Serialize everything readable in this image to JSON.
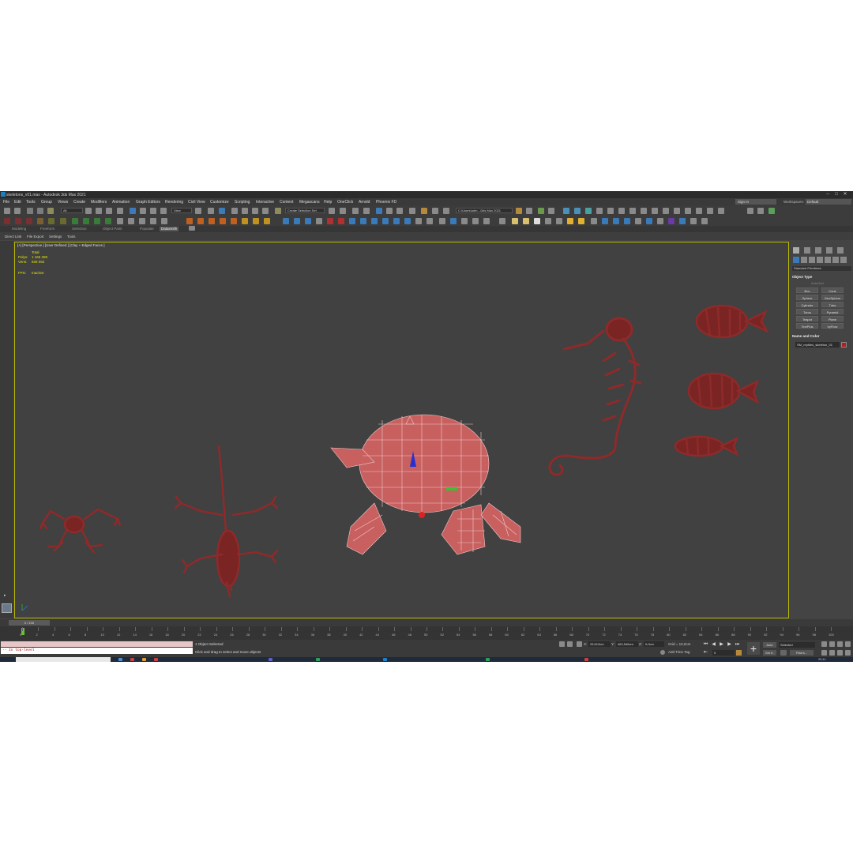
{
  "window": {
    "title": "skeletons_v01.max - Autodesk 3ds Max 2021",
    "controls": [
      "–",
      "□",
      "✕"
    ]
  },
  "menu": {
    "items": [
      "File",
      "Edit",
      "Tools",
      "Group",
      "Views",
      "Create",
      "Modifiers",
      "Animation",
      "Graph Editors",
      "Rendering",
      "Civil View",
      "Customize",
      "Scripting",
      "Interactive",
      "Content",
      "Megascans",
      "Help",
      "OneClick",
      "Arnold",
      "Phoenix FD"
    ],
    "sign_in": "Sign In",
    "workspaces_label": "Workspaces:",
    "workspaces_value": "Default"
  },
  "toolbar": {
    "filter_value": "All",
    "view_value": "View",
    "selection_set": "Create Selection Set",
    "project_path": "C:\\Users\\adm...\\3ds Max 2021"
  },
  "ribbon": {
    "tabs": [
      "Modeling",
      "Freeform",
      "Selection",
      "Object Paint",
      "Populate",
      "Datasmith"
    ],
    "active_tab": "Datasmith"
  },
  "subribbon": {
    "items": [
      "Direct Link",
      "File Export",
      "Settings",
      "Tools"
    ]
  },
  "viewport": {
    "label": "[+] [Perspective ] [User Defined ] [Clay + Edged Faces ]",
    "stats": {
      "total_label": "Total",
      "polys_label": "Polys:",
      "polys_value": "1 166 288",
      "verts_label": "Verts:",
      "verts_value": "925 092",
      "fps_label": "FPS:",
      "fps_value": "Inactive"
    }
  },
  "command_panel": {
    "category": "Standard Primitives",
    "object_type_header": "Object Type",
    "autogrid": "AutoGrid",
    "object_buttons": [
      "Box",
      "Cone",
      "Sphere",
      "GeoSphere",
      "Cylinder",
      "Tube",
      "Torus",
      "Pyramid",
      "Teapot",
      "Plane",
      "TextPlus",
      "hyFlow"
    ],
    "name_color_header": "Name and Color",
    "object_name": "SM_reptiles_skeleton_01",
    "object_color": "#b02020"
  },
  "timeline": {
    "thumb_label": "0 / 100",
    "ticks": [
      "0",
      "2",
      "4",
      "6",
      "8",
      "10",
      "12",
      "14",
      "16",
      "18",
      "20",
      "22",
      "24",
      "26",
      "28",
      "30",
      "32",
      "34",
      "36",
      "38",
      "40",
      "42",
      "44",
      "46",
      "48",
      "50",
      "52",
      "54",
      "56",
      "58",
      "60",
      "62",
      "64",
      "66",
      "68",
      "70",
      "72",
      "74",
      "76",
      "78",
      "80",
      "82",
      "84",
      "86",
      "88",
      "90",
      "92",
      "94",
      "96",
      "98",
      "100"
    ]
  },
  "status": {
    "maxscript_output": "-- In top-level",
    "selection": "1 Object Selected",
    "hint": "Click and drag to select and move objects",
    "x_label": "X:",
    "x_value": "25,513cm",
    "y_label": "Y:",
    "y_value": "462,546cm",
    "z_label": "Z:",
    "z_value": "0,0cm",
    "grid": "Grid = 10,0cm",
    "add_time_tag": "Add Time Tag",
    "frame": "0",
    "auto_key": "Auto",
    "key_mode": "Selected",
    "set_key": "Set K.",
    "filters": "Filters..."
  },
  "taskbar": {
    "clock": "20:11"
  }
}
